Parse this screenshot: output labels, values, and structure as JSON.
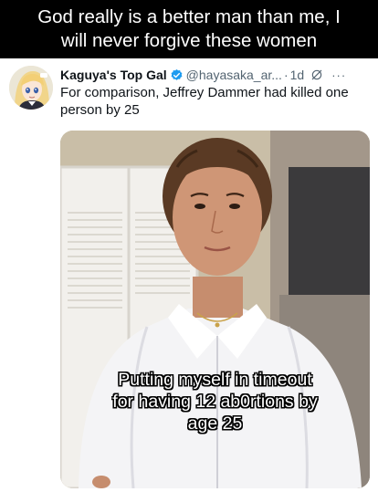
{
  "meme": {
    "caption_line1": "God really is a better man than me, I",
    "caption_line2": "will never forgive these women"
  },
  "tweet": {
    "display_name": "Kaguya's Top Gal",
    "handle": "@hayasaka_ar...",
    "separator": "·",
    "time": "1d",
    "more_icon": "more-horizontal-icon",
    "verified_icon": "verified-badge-icon",
    "grok_icon": "grok-icon",
    "text": "For comparison, Jeffrey Dammer had killed one person by 25",
    "verified_color": "#1d9bf0"
  },
  "media": {
    "overlay_line1": "Putting myself in timeout",
    "overlay_line2": "for having 12 ab0rtions by",
    "overlay_line3": "age 25"
  }
}
